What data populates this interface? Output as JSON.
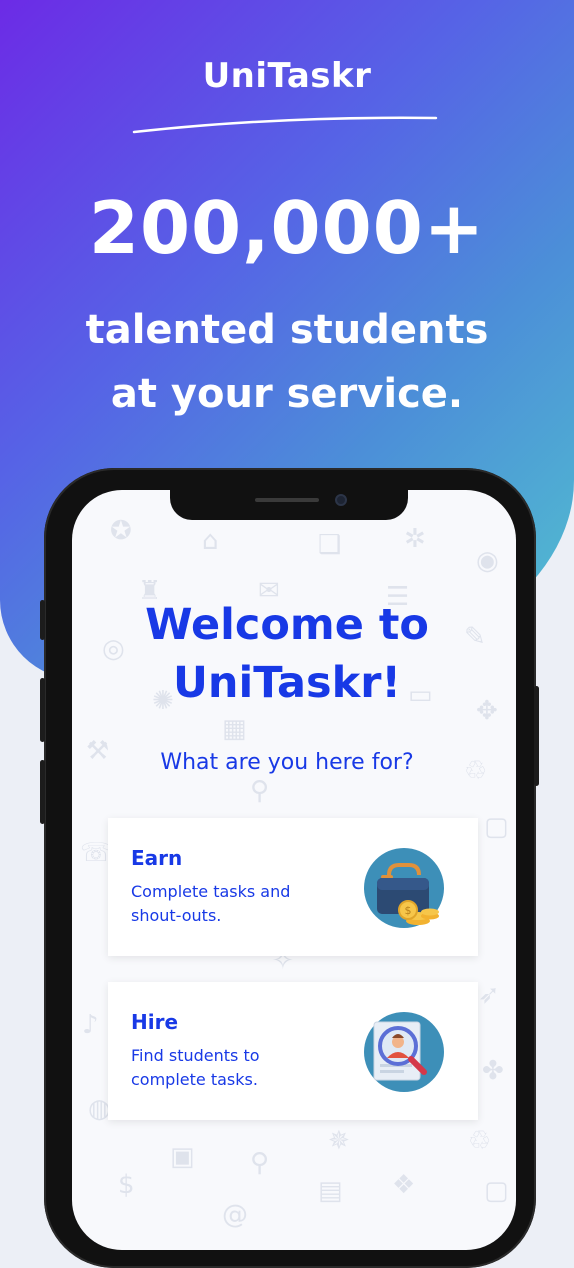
{
  "hero": {
    "brand": "UniTaskr",
    "big_number": "200,000+",
    "tagline_line1": "talented students",
    "tagline_line2": "at your service."
  },
  "screen": {
    "welcome_line1": "Welcome to",
    "welcome_line2": "UniTaskr!",
    "question": "What are you here for?",
    "cards": [
      {
        "title": "Earn",
        "description": "Complete tasks and shout-outs.",
        "icon": "briefcase-coins-icon"
      },
      {
        "title": "Hire",
        "description": "Find students to complete tasks.",
        "icon": "student-search-icon"
      }
    ]
  },
  "colors": {
    "accent_blue": "#1839e6",
    "gradient_start": "#6c2be6",
    "gradient_end": "#52c3cf",
    "page_background": "#eceff6"
  }
}
